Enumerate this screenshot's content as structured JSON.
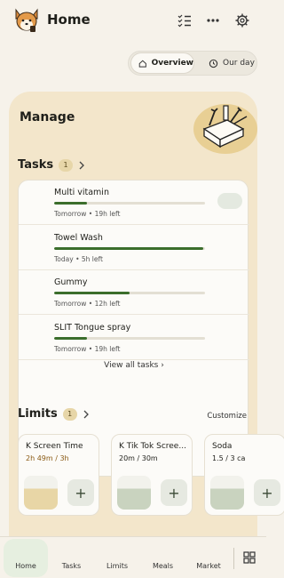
{
  "header": {
    "title": "Home"
  },
  "segments": {
    "overview_label": "Overview",
    "our_day_label": "Our day"
  },
  "manage": {
    "title": "Manage"
  },
  "tasks": {
    "title": "Tasks",
    "count": "1",
    "items": [
      {
        "name": "Multi vitamin",
        "meta": "Tomorrow • 19h left",
        "progress": 0.22,
        "pinned": true,
        "action": "check",
        "icon": "pill-icon"
      },
      {
        "name": "Towel Wash",
        "meta": "Today • 5h left",
        "progress": 0.99,
        "pinned": false,
        "action": "chevron",
        "icon": "washing-machine-icon"
      },
      {
        "name": "Gummy",
        "meta": "Tomorrow • 12h left",
        "progress": 0.5,
        "pinned": false,
        "action": "chevron",
        "icon": "pill-icon"
      },
      {
        "name": "SLIT Tongue spray",
        "meta": "Tomorrow • 19h left",
        "progress": 0.22,
        "pinned": false,
        "action": "chevron",
        "icon": "pill-icon"
      }
    ],
    "view_all_label": "View all tasks"
  },
  "limits": {
    "title": "Limits",
    "count": "1",
    "customize_label": "Customize",
    "items": [
      {
        "name": "K Screen Time",
        "usage": "2h 49m / 3h",
        "status": "warning",
        "icon": "tv-icon",
        "usage_color": "#8a5a14",
        "tile_color": "#e8d6a6"
      },
      {
        "name": "K Tik Tok Scree...",
        "usage": "20m / 30m",
        "status": "ok",
        "icon": "phone-icon",
        "usage_color": "#1f1f1a",
        "tile_color": "#c9d3bf"
      },
      {
        "name": "Soda",
        "usage": "1.5 / 3 ca",
        "status": "none",
        "icon": "cup-icon",
        "usage_color": "#1f1f1a",
        "tile_color": "#c9d3bf"
      }
    ]
  },
  "nav": {
    "items": [
      {
        "label": "Home",
        "icon": "home-icon",
        "active": true
      },
      {
        "label": "Tasks",
        "icon": "checklist-icon",
        "active": false
      },
      {
        "label": "Limits",
        "icon": "limits-icon",
        "active": false
      },
      {
        "label": "Meals",
        "icon": "fork-knife-icon",
        "active": false
      },
      {
        "label": "Market",
        "icon": "tag-icon",
        "active": false
      }
    ]
  }
}
